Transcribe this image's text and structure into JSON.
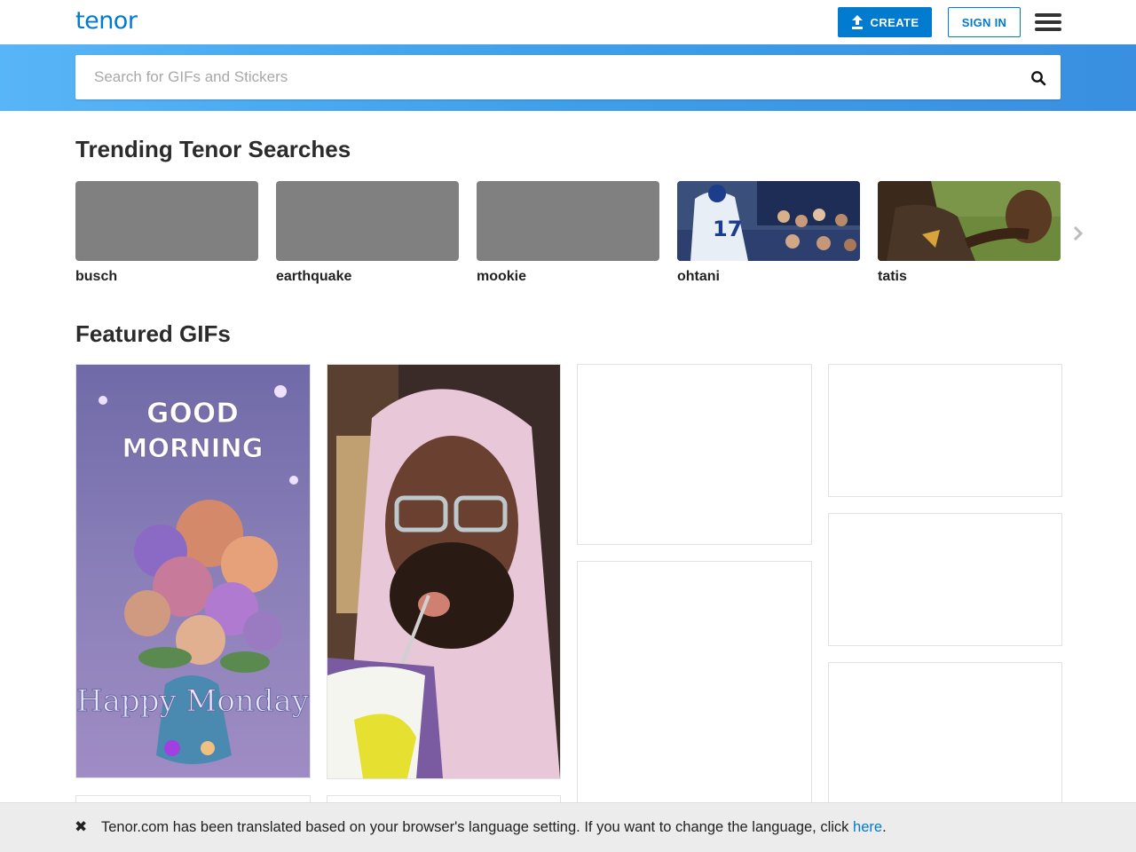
{
  "header": {
    "logo": "tenor",
    "create_label": "CREATE",
    "signin_label": "SIGN IN",
    "accent": "#007bcf"
  },
  "search": {
    "placeholder": "Search for GIFs and Stickers"
  },
  "trending": {
    "title": "Trending Tenor Searches",
    "items": [
      {
        "label": "busch"
      },
      {
        "label": "earthquake"
      },
      {
        "label": "mookie"
      },
      {
        "label": "ohtani"
      },
      {
        "label": "tatis"
      }
    ]
  },
  "featured": {
    "title": "Featured GIFs",
    "gifs": [
      {
        "caption_top_1": "GOOD",
        "caption_top_2": "MORNING",
        "caption_bottom": "Happy Monday"
      }
    ]
  },
  "banner": {
    "close": "✖",
    "message": "Tenor.com has been translated based on your browser's language setting. If you want to change the language, click ",
    "link": "here",
    "end": "."
  }
}
